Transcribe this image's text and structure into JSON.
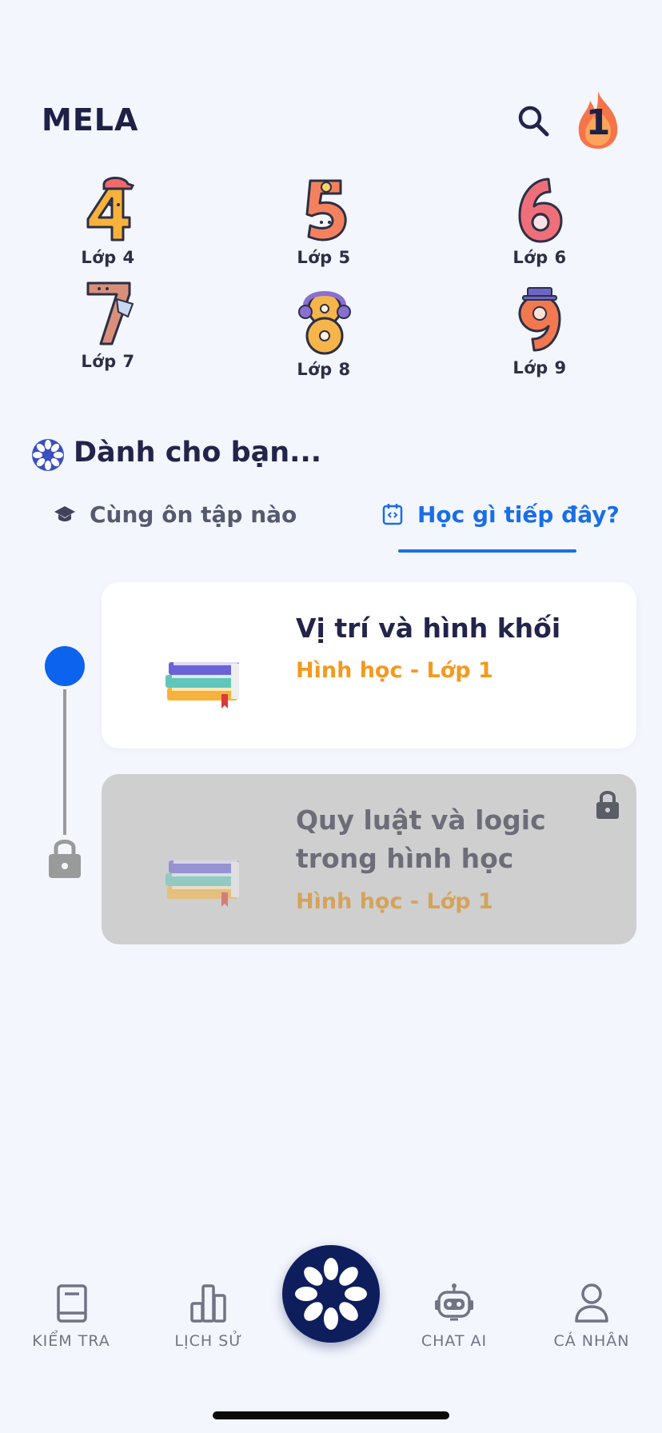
{
  "header": {
    "app_title": "MELA",
    "streak_count": "1"
  },
  "grades": [
    {
      "label": "Lớp 4",
      "numeral": "4",
      "color": "#f7b23b"
    },
    {
      "label": "Lớp 5",
      "numeral": "5",
      "color": "#f4815d"
    },
    {
      "label": "Lớp 6",
      "numeral": "6",
      "color": "#ee6f7a"
    },
    {
      "label": "Lớp 7",
      "numeral": "7",
      "color": "#d9907b"
    },
    {
      "label": "Lớp 8",
      "numeral": "8",
      "color": "#f6b54a"
    },
    {
      "label": "Lớp 9",
      "numeral": "9",
      "color": "#f27850"
    }
  ],
  "section": {
    "title": "Dành cho bạn..."
  },
  "tabs": [
    {
      "label": "Cùng ôn tập nào",
      "icon": "graduation-cap-icon",
      "active": false
    },
    {
      "label": "Học gì tiếp đây?",
      "icon": "calendar-code-icon",
      "active": true
    }
  ],
  "lessons": [
    {
      "title": "Vị trí và hình khối",
      "subtitle": "Hình học - Lớp 1",
      "locked": false,
      "icon": "books-icon"
    },
    {
      "title": "Quy luật và logic trong hình học",
      "subtitle": "Hình học - Lớp 1",
      "locked": true,
      "icon": "books-icon"
    }
  ],
  "bottom_nav": [
    {
      "label": "KIỂM TRA",
      "icon": "book-icon"
    },
    {
      "label": "LỊCH SỬ",
      "icon": "bar-chart-icon"
    },
    {
      "label": "",
      "icon": "mela-wheel-icon"
    },
    {
      "label": "CHAT AI",
      "icon": "robot-icon"
    },
    {
      "label": "CÁ NHÂN",
      "icon": "user-icon"
    }
  ],
  "colors": {
    "accent": "#1a6ee6",
    "timeline_active": "#0c63ee",
    "subtitle_orange": "#f29a20",
    "nav_center": "#0e1d5c",
    "background": "#f3f6fd"
  }
}
